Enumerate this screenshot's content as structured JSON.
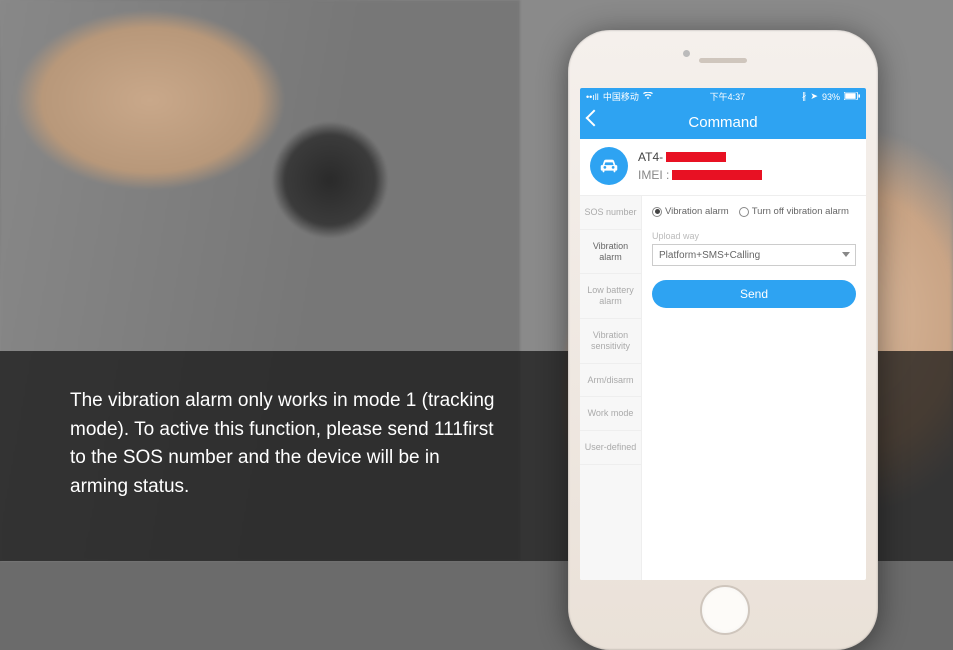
{
  "caption": "The vibration alarm only works in mode 1 (tracking mode). To active this function, please send 111first to the SOS number and the device will be in arming status.",
  "status": {
    "carrier": "中国移动",
    "time": "下午4:37",
    "battery": "93%"
  },
  "nav": {
    "title": "Command"
  },
  "device": {
    "name_prefix": "AT4-",
    "imei_label": "IMEI :"
  },
  "sidebar": {
    "items": [
      {
        "label": "SOS number"
      },
      {
        "label": "Vibration alarm"
      },
      {
        "label": "Low battery alarm"
      },
      {
        "label": "Vibration sensitivity"
      },
      {
        "label": "Arm/disarm"
      },
      {
        "label": "Work mode"
      },
      {
        "label": "User-defined"
      }
    ]
  },
  "content": {
    "radio_on": "Vibration alarm",
    "radio_off": "Turn off vibration alarm",
    "upload_label": "Upload way",
    "upload_value": "Platform+SMS+Calling",
    "send_label": "Send"
  }
}
